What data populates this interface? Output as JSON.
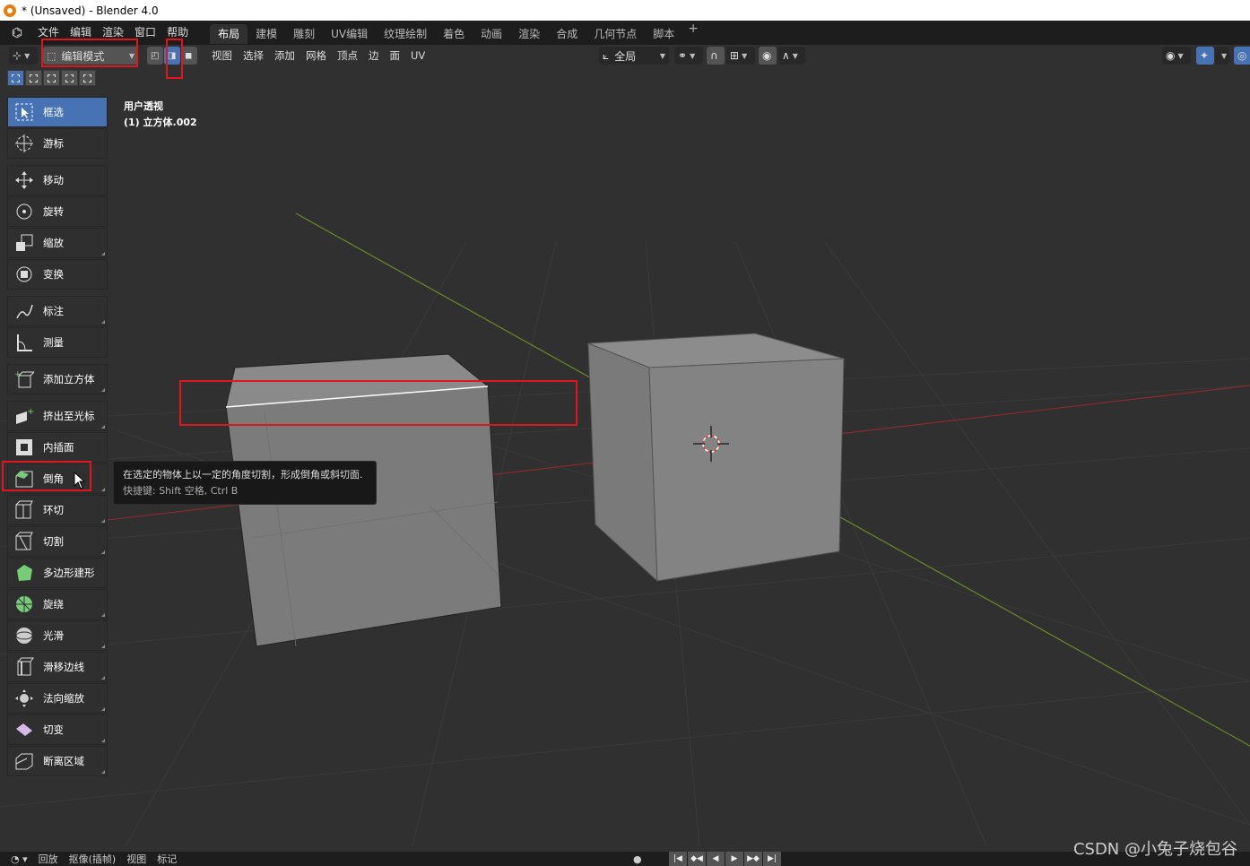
{
  "titlebar": {
    "title": "* (Unsaved) - Blender 4.0"
  },
  "menubar": {
    "items": [
      "文件",
      "编辑",
      "渲染",
      "窗口",
      "帮助"
    ],
    "workspaces": [
      "布局",
      "建模",
      "雕刻",
      "UV编辑",
      "纹理绘制",
      "着色",
      "动画",
      "渲染",
      "合成",
      "几何节点",
      "脚本"
    ],
    "active_workspace": "布局",
    "add_tab": "+"
  },
  "header": {
    "mode": "编辑模式",
    "menus": [
      "视图",
      "选择",
      "添加",
      "网格",
      "顶点",
      "边",
      "面",
      "UV"
    ],
    "transform_orientation": "全局"
  },
  "viewport": {
    "view_name": "用户透视",
    "object_name": "(1) 立方体.002"
  },
  "toolbar": {
    "tools": [
      {
        "label": "框选",
        "icon": "select-box-icon",
        "active": true
      },
      {
        "label": "游标",
        "icon": "cursor-icon"
      },
      {
        "label": "移动",
        "icon": "move-icon"
      },
      {
        "label": "旋转",
        "icon": "rotate-icon"
      },
      {
        "label": "缩放",
        "icon": "scale-icon"
      },
      {
        "label": "变换",
        "icon": "transform-icon"
      },
      {
        "label": "标注",
        "icon": "annotate-icon"
      },
      {
        "label": "测量",
        "icon": "measure-icon"
      },
      {
        "label": "添加立方体",
        "icon": "add-cube-icon"
      },
      {
        "label": "挤出至光标",
        "icon": "extrude-icon"
      },
      {
        "label": "内插面",
        "icon": "inset-icon"
      },
      {
        "label": "倒角",
        "icon": "bevel-icon"
      },
      {
        "label": "环切",
        "icon": "loop-cut-icon"
      },
      {
        "label": "切割",
        "icon": "knife-icon"
      },
      {
        "label": "多边形建形",
        "icon": "poly-build-icon"
      },
      {
        "label": "旋绕",
        "icon": "spin-icon"
      },
      {
        "label": "光滑",
        "icon": "smooth-icon"
      },
      {
        "label": "滑移边线",
        "icon": "edge-slide-icon"
      },
      {
        "label": "法向缩放",
        "icon": "shrink-fatten-icon"
      },
      {
        "label": "切变",
        "icon": "shear-icon"
      },
      {
        "label": "断离区域",
        "icon": "rip-region-icon"
      }
    ]
  },
  "tooltip": {
    "description": "在选定的物体上以一定的角度切割，形成倒角或斜切面.",
    "shortcut": "快捷键: Shift 空格, Ctrl B"
  },
  "timeline": {
    "items": [
      "回放",
      "抠像(插帧)",
      "视图",
      "标记"
    ]
  },
  "watermark": "CSDN @小兔子烧包谷",
  "colors": {
    "accent": "#4772b3",
    "annotation": "#e0161f",
    "viewport_bg": "#303030",
    "axis_x": "#8b2a2e",
    "axis_y": "#6a8a2a"
  }
}
